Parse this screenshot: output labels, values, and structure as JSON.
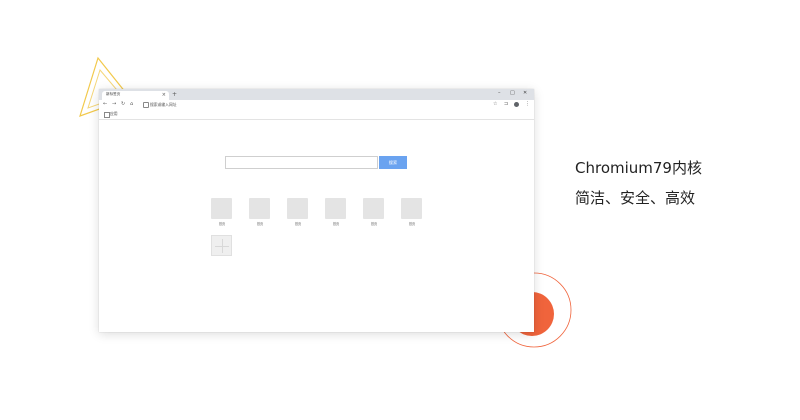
{
  "browser": {
    "tab_title": "新标签页",
    "tab_close": "×",
    "new_tab": "+",
    "window_controls": {
      "minimize": "–",
      "maximize": "□",
      "close": "✕"
    },
    "nav": {
      "back": "←",
      "forward": "→",
      "reload": "↻",
      "home": "⌂"
    },
    "address_placeholder": "搜索或输入网址",
    "toolbar_right": {
      "star": "☆",
      "extension": "⊐",
      "menu": "⋮"
    },
    "bookmark_label": "应用",
    "search_button": "搜索",
    "shortcuts": [
      {
        "label": "首页"
      },
      {
        "label": "首页"
      },
      {
        "label": "首页"
      },
      {
        "label": "首页"
      },
      {
        "label": "首页"
      },
      {
        "label": "首页"
      }
    ]
  },
  "features": {
    "line1": "Chromium79内核",
    "line2": "简洁、安全、高效"
  },
  "colors": {
    "accent_orange": "#f0643c",
    "deco_yellow": "#f2c94c",
    "search_button": "#6aa3f0"
  }
}
